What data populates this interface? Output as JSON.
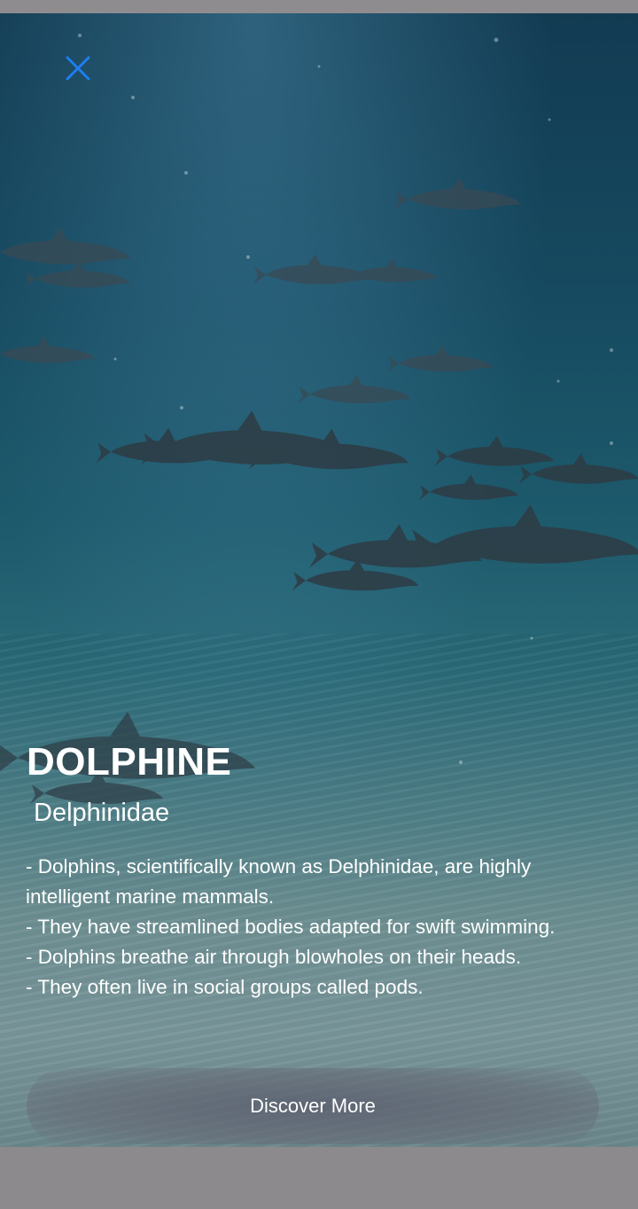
{
  "close": {
    "icon": "close-icon",
    "color": "#1e7ef0"
  },
  "animal": {
    "name": "DOLPHINE",
    "scientific_name": "Delphinidae",
    "facts": [
      "- Dolphins, scientifically known as Delphinidae, are highly intelligent marine mammals.",
      "- They have streamlined bodies adapted for swift swimming.",
      "- Dolphins breathe air through blowholes on their heads.",
      "- They often live in social groups called pods."
    ]
  },
  "actions": {
    "discover_label": "Discover More"
  }
}
